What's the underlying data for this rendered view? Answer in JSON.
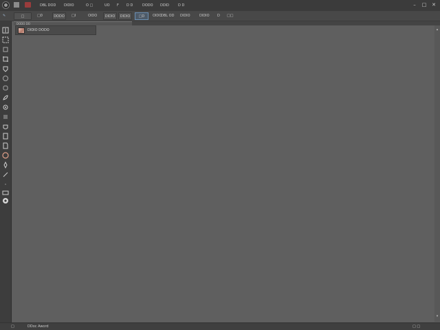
{
  "menubar": {
    "items": [
      {
        "label": "DBL DOD"
      },
      {
        "label": "DIDIO"
      },
      {
        "label": "O □"
      },
      {
        "label": "UO"
      },
      {
        "label": "F"
      },
      {
        "label": "D D"
      },
      {
        "label": "DODO"
      },
      {
        "label": "DDID"
      },
      {
        "label": "D D"
      }
    ],
    "window_controls": {
      "minimize": "–",
      "maximize": "□",
      "close": "✕"
    }
  },
  "optionsbar": {
    "items": [
      {
        "label": "□"
      },
      {
        "label": "□0"
      },
      {
        "label": "DODO"
      },
      {
        "label": "□I"
      },
      {
        "label": "OIDO"
      },
      {
        "label": "DIDIO"
      },
      {
        "label": "DIDIO"
      },
      {
        "label": "□D"
      },
      {
        "label": "OIDO"
      },
      {
        "label": "DBL OD"
      },
      {
        "label": "DIDIO"
      },
      {
        "label": "DIDIO"
      },
      {
        "label": "D"
      },
      {
        "label": "□□"
      }
    ]
  },
  "tab": {
    "label": "DODO DO"
  },
  "layer": {
    "name": "DIDIO DODO"
  },
  "status": {
    "zoom": "□",
    "doc_info": "DDoc Aword",
    "right": "□ □"
  },
  "colors": {
    "accent": "#6b8fb3",
    "red_icon": "#9a3c3c",
    "canvas": "#5f5f5f"
  },
  "icons": [
    "app-logo-icon",
    "home-icon",
    "window-icon",
    "move-icon",
    "marquee-icon",
    "lasso-icon",
    "crop-icon",
    "frame-icon",
    "eyedropper-icon",
    "healing-icon",
    "brush-icon",
    "clone-icon",
    "history-icon",
    "eraser-icon",
    "gradient-icon",
    "blur-icon",
    "dodge-icon",
    "pen-icon",
    "text-icon",
    "path-icon",
    "shape-icon",
    "hand-icon",
    "zoom-icon"
  ]
}
